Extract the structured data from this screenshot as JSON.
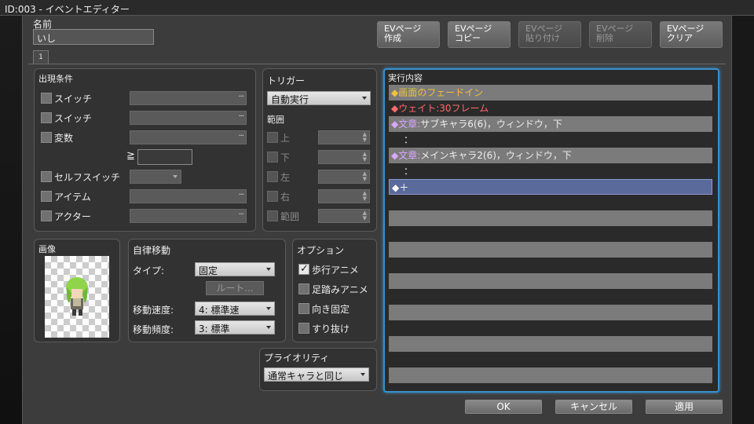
{
  "title": "ID:003 - イベントエディター",
  "name": {
    "label": "名前",
    "value": "いし"
  },
  "tab": "1",
  "top_buttons": [
    "EVページ\n作成",
    "EVページ\nコピー",
    "EVページ\n貼り付け",
    "EVページ\n削除",
    "EVページ\nクリア"
  ],
  "conditions": {
    "title": "出現条件",
    "items": [
      "スイッチ",
      "スイッチ",
      "変数",
      "セルフスイッチ",
      "アイテム",
      "アクター"
    ],
    "gte": "≧",
    "dots": "···"
  },
  "trigger": {
    "title": "トリガー",
    "value": "自動実行",
    "range_label": "範囲",
    "directions": [
      "上",
      "下",
      "左",
      "右",
      "範囲"
    ]
  },
  "image": {
    "title": "画像"
  },
  "movement": {
    "title": "自律移動",
    "type_label": "タイプ:",
    "type_value": "固定",
    "route_button": "ルート...",
    "speed_label": "移動速度:",
    "speed_value": "4: 標準速",
    "freq_label": "移動頻度:",
    "freq_value": "3: 標準"
  },
  "options": {
    "title": "オプション",
    "items": [
      {
        "label": "歩行アニメ",
        "checked": true
      },
      {
        "label": "足踏みアニメ",
        "checked": false
      },
      {
        "label": "向き固定",
        "checked": false
      },
      {
        "label": "すり抜け",
        "checked": false
      }
    ]
  },
  "priority": {
    "title": "プライオリティ",
    "value": "通常キャラと同じ"
  },
  "contents": {
    "title": "実行内容",
    "rows": [
      {
        "text": "◆画面のフェードイン",
        "color": "#f0c040"
      },
      {
        "text": "◆ウェイト:30フレーム",
        "color": "#ff6a6a"
      },
      {
        "text": "◆文章:サブキャラ6(6)，ウィンドウ，下",
        "prefix": "◆文章:",
        "rest": "サブキャラ6(6)，ウィンドウ，下",
        "color": "#d8a8ff"
      },
      {
        "text": "：",
        "indent": true
      },
      {
        "text": "◆文章:メインキャラ2(6)，ウィンドウ，下",
        "prefix": "◆文章:",
        "rest": "メインキャラ2(6)，ウィンドウ，下",
        "color": "#d8a8ff"
      },
      {
        "text": "：",
        "indent": true
      },
      {
        "text": "◆＋",
        "selected": true
      }
    ],
    "empty_rows": 12
  },
  "footer": {
    "ok": "OK",
    "cancel": "キャンセル",
    "apply": "適用"
  }
}
